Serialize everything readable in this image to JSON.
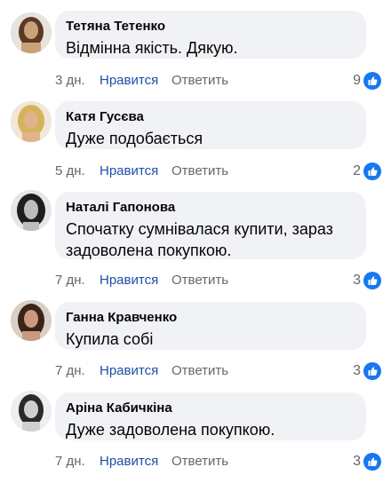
{
  "labels": {
    "like": "Нравится",
    "reply": "Ответить"
  },
  "colors": {
    "like": "#1d4ea8",
    "secondary": "#65676b",
    "bubble": "#f0f2f5",
    "reaction": "#1877f2"
  },
  "comments": [
    {
      "author": "Тетяна Тетенко",
      "lines": [
        "Відмінна якість. Дякую."
      ],
      "time": "3 дн.",
      "likes": "9",
      "avatar_tone": "#c9a27a",
      "avatar_hair": "#5a3a22"
    },
    {
      "author": "Катя Гусєва",
      "lines": [
        "Дуже подобається"
      ],
      "time": "5 дн.",
      "likes": "2",
      "avatar_tone": "#e0b48a",
      "avatar_hair": "#d6b25a"
    },
    {
      "author": "Наталі Гапонова",
      "lines": [
        "Спочатку сумнівалася купити, зараз",
        "задоволена покупкою."
      ],
      "time": "7 дн.",
      "likes": "3",
      "avatar_tone": "#bdbdbd",
      "avatar_hair": "#1e1e1e"
    },
    {
      "author": "Ганна Кравченко",
      "lines": [
        "Купила собі"
      ],
      "time": "7 дн.",
      "likes": "3",
      "avatar_tone": "#c89b80",
      "avatar_hair": "#3a2418"
    },
    {
      "author": "Аріна Кабичкіна",
      "lines": [
        "Дуже задоволена покупкою."
      ],
      "time": "7 дн.",
      "likes": "3",
      "avatar_tone": "#cfcfcf",
      "avatar_hair": "#2a2a2a"
    }
  ]
}
